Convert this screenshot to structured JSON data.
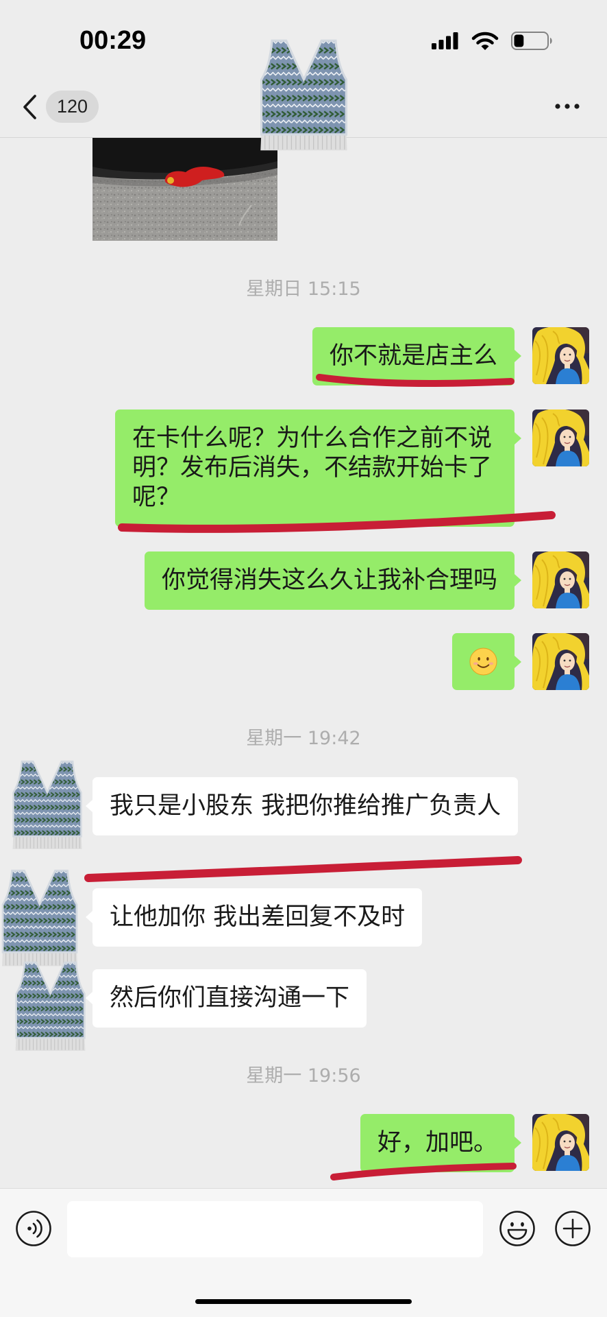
{
  "status_bar": {
    "time": "00:29",
    "battery_level": 0.3
  },
  "nav": {
    "unread_count": "120"
  },
  "chat": {
    "timestamps": [
      "星期日 15:15",
      "星期一 19:42",
      "星期一 19:56"
    ],
    "sent": [
      {
        "text": "你不就是店主么",
        "underlined": true
      },
      {
        "text": "在卡什么呢？为什么合作之前不说明？发布后消失，不结款开始卡了呢？",
        "underlined": true
      },
      {
        "text": "你觉得消失这么久让我补合理吗",
        "underlined": false
      },
      {
        "emoji_icon": "smiling-face-icon"
      },
      {
        "text": "好，加吧。",
        "underlined": true
      }
    ],
    "received": [
      {
        "text": "我只是小股东 我把你推给推广负责人",
        "underlined": true
      },
      {
        "text": "让他加你 我出差回复不及时",
        "underlined": false
      },
      {
        "text": "然后你们直接沟通一下",
        "underlined": false
      }
    ]
  },
  "input": {
    "value": ""
  },
  "icons": {
    "signal": "signal-icon",
    "wifi": "wifi-icon",
    "battery": "battery-icon",
    "back": "chevron-left-icon",
    "more": "more-icon",
    "voice": "voice-icon",
    "emoji": "emoji-icon",
    "plus": "plus-icon"
  },
  "colors": {
    "chat_background": "#ededed",
    "sent_bubble": "#95ec69",
    "received_bubble": "#ffffff",
    "annotation_mark": "#c81e36"
  }
}
